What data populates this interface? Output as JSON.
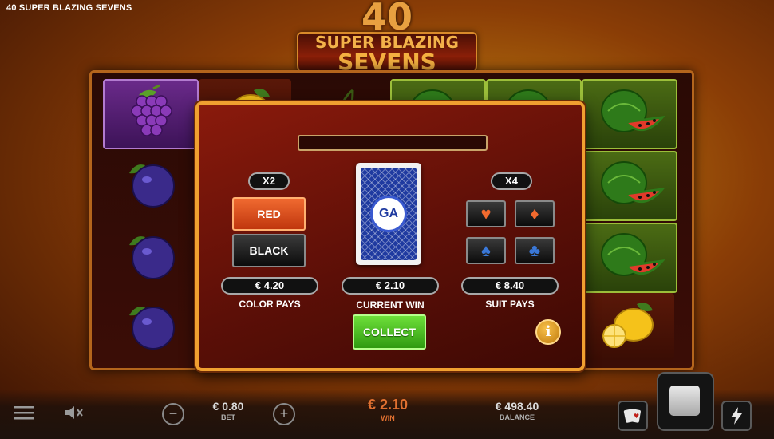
{
  "window": {
    "title": "40 SUPER BLAZING SEVENS"
  },
  "logo": {
    "number": "40",
    "line1": "SUPER BLAZING",
    "line2": "SEVENS"
  },
  "reels": [
    [
      "grapes",
      "plum",
      "plum",
      "plum"
    ],
    [
      "lemon",
      "",
      "",
      ""
    ],
    [
      "cherry",
      "",
      "",
      ""
    ],
    [
      "watermelon",
      "",
      "",
      ""
    ],
    [
      "watermelon",
      "",
      "",
      ""
    ],
    [
      "watermelon",
      "watermelon",
      "watermelon",
      "lemon"
    ]
  ],
  "gamble": {
    "color_multiplier": "X2",
    "suit_multiplier": "X4",
    "red_label": "RED",
    "black_label": "BLACK",
    "color_pays": {
      "value": "€ 4.20",
      "label": "COLOR PAYS"
    },
    "current_win": {
      "value": "€ 2.10",
      "label": "CURRENT WIN"
    },
    "suit_pays": {
      "value": "€ 8.40",
      "label": "SUIT PAYS"
    },
    "card_logo": "GA",
    "suits": [
      "♥",
      "♦",
      "♠",
      "♣"
    ],
    "collect_label": "COLLECT",
    "info_label": "i"
  },
  "bottom_bar": {
    "bet": {
      "value": "€ 0.80",
      "label": "BET"
    },
    "win": {
      "value": "€ 2.10",
      "label": "WIN"
    },
    "balance": {
      "value": "€ 498.40",
      "label": "BALANCE"
    },
    "minus": "−",
    "plus": "+"
  },
  "colors": {
    "accent_orange": "#f0a030",
    "collect_green": "#4cc224",
    "red_button": "#e0501c",
    "win_orange": "#e07030"
  }
}
